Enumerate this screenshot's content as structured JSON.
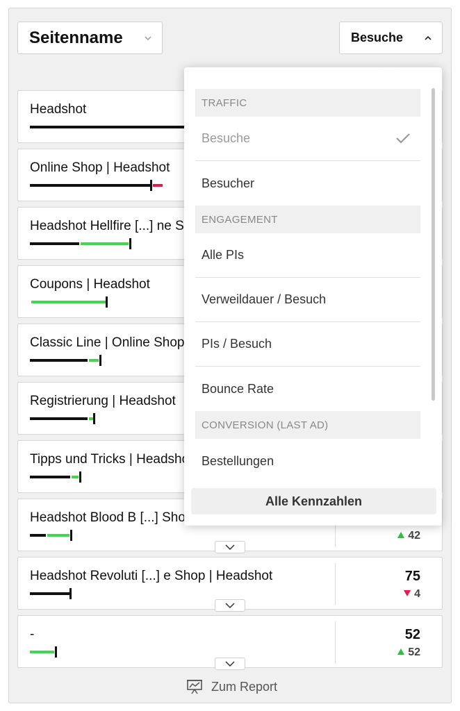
{
  "header": {
    "page_select_label": "Seitenname",
    "metric_select_label": "Besuche"
  },
  "rows": [
    {
      "name": "Headshot",
      "value": "",
      "delta": "",
      "trend": ""
    },
    {
      "name": "Online Shop | Headshot",
      "value": "",
      "delta": "",
      "trend": ""
    },
    {
      "name": "Headshot Hellfire [...] ne Shop | Headshot",
      "value": "",
      "delta": "",
      "trend": ""
    },
    {
      "name": "Coupons | Headshot",
      "value": "",
      "delta": "",
      "trend": ""
    },
    {
      "name": "Classic Line | Online Shop | Headshot",
      "value": "",
      "delta": "",
      "trend": ""
    },
    {
      "name": "Registrierung | Headshot",
      "value": "",
      "delta": "",
      "trend": ""
    },
    {
      "name": "Tipps und Tricks | Headshot",
      "value": "",
      "delta": "",
      "trend": ""
    },
    {
      "name": "Headshot Blood B [...] Shop | Headshot",
      "value": "",
      "delta": "42",
      "trend": "up"
    },
    {
      "name": "Headshot Revoluti [...] e Shop | Headshot",
      "value": "75",
      "delta": "4",
      "trend": "down"
    },
    {
      "name": "-",
      "value": "52",
      "delta": "52",
      "trend": "up"
    }
  ],
  "dropdown": {
    "groups": [
      {
        "header": "TRAFFIC",
        "items": [
          {
            "label": "Besuche",
            "selected": true
          },
          {
            "label": "Besucher",
            "selected": false
          }
        ]
      },
      {
        "header": "ENGAGEMENT",
        "items": [
          {
            "label": "Alle PIs",
            "selected": false
          },
          {
            "label": "Verweildauer / Besuch",
            "selected": false
          },
          {
            "label": "PIs / Besuch",
            "selected": false
          },
          {
            "label": "Bounce Rate",
            "selected": false
          }
        ]
      },
      {
        "header": "CONVERSION (LAST AD)",
        "items": [
          {
            "label": "Bestellungen",
            "selected": false
          }
        ]
      }
    ],
    "footer_label": "Alle Kennzahlen"
  },
  "footer": {
    "report_link_label": "Zum Report"
  },
  "colors": {
    "positive": "#41d94a",
    "negative": "#e8184a",
    "bar_base": "#111111",
    "panel_bg": "#f0f0f0"
  },
  "icons": {
    "page_select": "chevron-down-icon",
    "metric_select": "chevron-up-icon",
    "row_expand": "chevron-down-icon",
    "selected_item": "check-icon",
    "report": "chart-presentation-icon"
  }
}
